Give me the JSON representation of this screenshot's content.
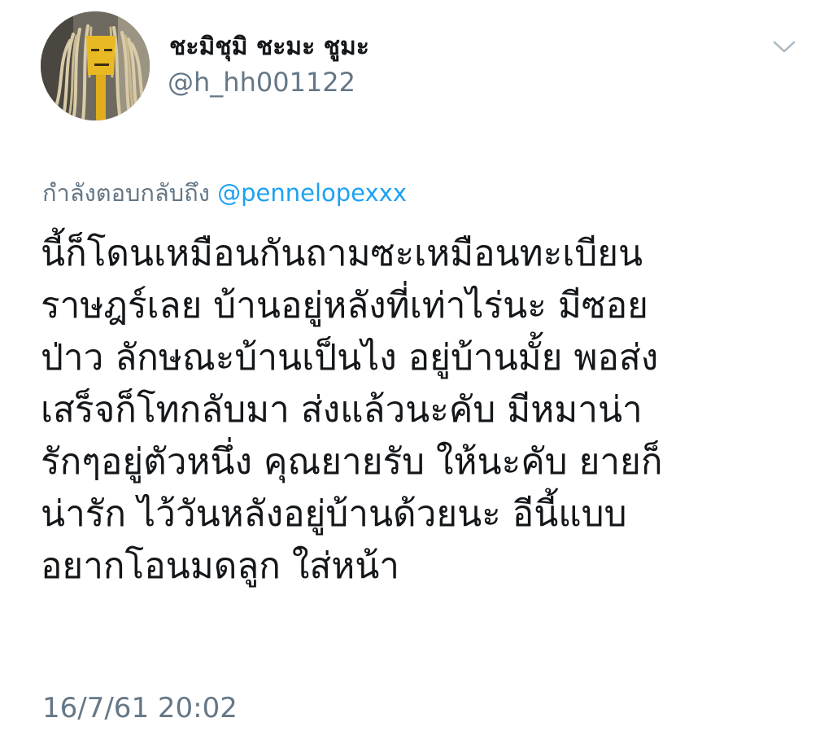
{
  "author": {
    "display_name": "ชะมิชุมิ ชะมะ ชูมะ",
    "handle": "@h_hh001122",
    "avatar_icon": "mop-face-avatar"
  },
  "header": {
    "menu_icon": "chevron-down-icon"
  },
  "reply": {
    "prefix": "กำลังตอบกลับถึง",
    "mention": "@pennelopexxx"
  },
  "tweet": {
    "lines": [
      "นี้ก็โดนเหมือนกันถามซะเหมือนทะเบียน",
      "ราษฎร์เลย บ้านอยู่หลังที่เท่าไร่นะ มีซอย",
      "ป่าว ลักษณะบ้านเป็นไง อยู่บ้านมั้ย พอส่ง",
      "เสร็จก็โทกลับมา ส่งแล้วนะคับ มีหมาน่า",
      "รักๆอยู่ตัวหนึ่ง คุณยายรับ ให้นะคับ ยายก็",
      "น่ารัก ไว้วันหลังอยู่บ้านด้วยนะ อีนี้แบบ",
      "อยากโอนมดลูก ใส่หน้า"
    ],
    "timestamp": "16/7/61 20:02"
  },
  "colors": {
    "text": "#14171a",
    "secondary": "#657786",
    "link": "#1da1f2",
    "chevron": "#aab8c2"
  }
}
